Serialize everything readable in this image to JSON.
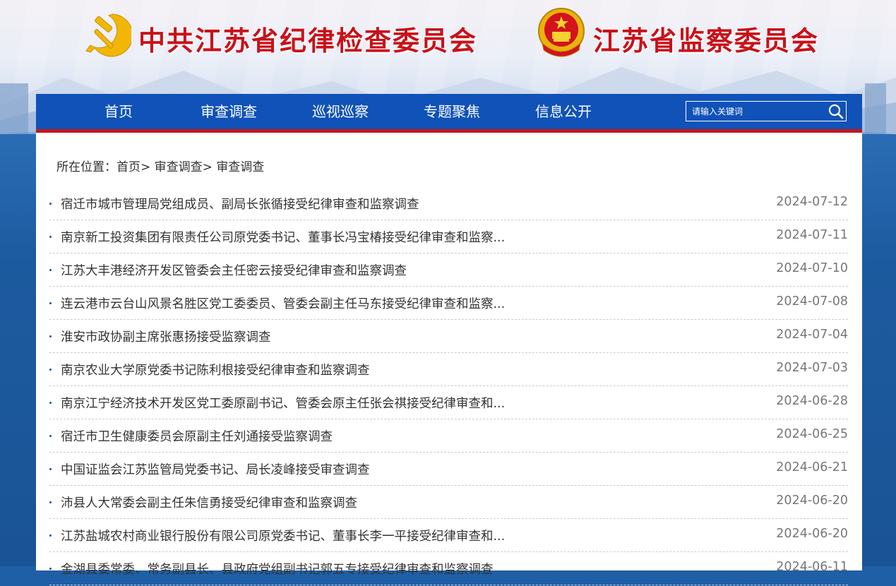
{
  "header": {
    "party_title": "中共江苏省纪律检查委员会",
    "state_title": "江苏省监察委员会"
  },
  "nav": {
    "items": [
      {
        "label": "首页"
      },
      {
        "label": "审查调查"
      },
      {
        "label": "巡视巡察"
      },
      {
        "label": "专题聚焦"
      },
      {
        "label": "信息公开"
      }
    ],
    "search_placeholder": "请输入关键词"
  },
  "breadcrumb": {
    "prefix": "所在位置：",
    "items": [
      "首页",
      "审查调查",
      "审查调查"
    ],
    "separator": ">"
  },
  "news": [
    {
      "title": "宿迁市城市管理局党组成员、副局长张循接受纪律审查和监察调查",
      "date": "2024-07-12"
    },
    {
      "title": "南京新工投资集团有限责任公司原党委书记、董事长冯宝椿接受纪律审查和监察...",
      "date": "2024-07-11"
    },
    {
      "title": "江苏大丰港经济开发区管委会主任密云接受纪律审查和监察调查",
      "date": "2024-07-10"
    },
    {
      "title": "连云港市云台山风景名胜区党工委委员、管委会副主任马东接受纪律审查和监察...",
      "date": "2024-07-08"
    },
    {
      "title": "淮安市政协副主席张惠扬接受监察调查",
      "date": "2024-07-04"
    },
    {
      "title": "南京农业大学原党委书记陈利根接受纪律审查和监察调查",
      "date": "2024-07-03"
    },
    {
      "title": "南京江宁经济技术开发区党工委原副书记、管委会原主任张会祺接受纪律审查和...",
      "date": "2024-06-28"
    },
    {
      "title": "宿迁市卫生健康委员会原副主任刘通接受监察调查",
      "date": "2024-06-25"
    },
    {
      "title": "中国证监会江苏监管局党委书记、局长凌峰接受审查调查",
      "date": "2024-06-21"
    },
    {
      "title": "沛县人大常委会副主任朱信勇接受纪律审查和监察调查",
      "date": "2024-06-20"
    },
    {
      "title": "江苏盐城农村商业银行股份有限公司原党委书记、董事长李一平接受纪律审查和...",
      "date": "2024-06-20"
    },
    {
      "title": "金湖县委常委、常务副县长、县政府党组副书记郭五专接受纪律审查和监察调查",
      "date": "2024-06-11"
    }
  ],
  "colors": {
    "nav_bg": "#1052b8",
    "nav_accent": "#c7151a",
    "title_red": "#c8121a"
  }
}
